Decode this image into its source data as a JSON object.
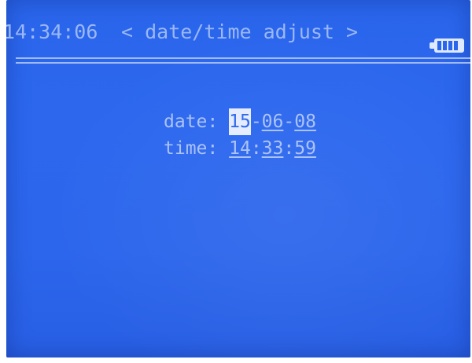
{
  "header": {
    "clock": "14:34:06",
    "title": "< date/time adjust >",
    "battery_icon": "battery-full-icon",
    "battery_level": 1.0
  },
  "date": {
    "label": "date:",
    "day": "15",
    "month": "06",
    "year": "08",
    "separator": "-",
    "selected_field": "day"
  },
  "time": {
    "label": "time:",
    "hours": "14",
    "minutes": "33",
    "seconds": "59",
    "separator": ":"
  },
  "colors": {
    "screen_bg": "#2c67ee",
    "text": "#a9c1f7",
    "highlight": "#e4ecff"
  }
}
